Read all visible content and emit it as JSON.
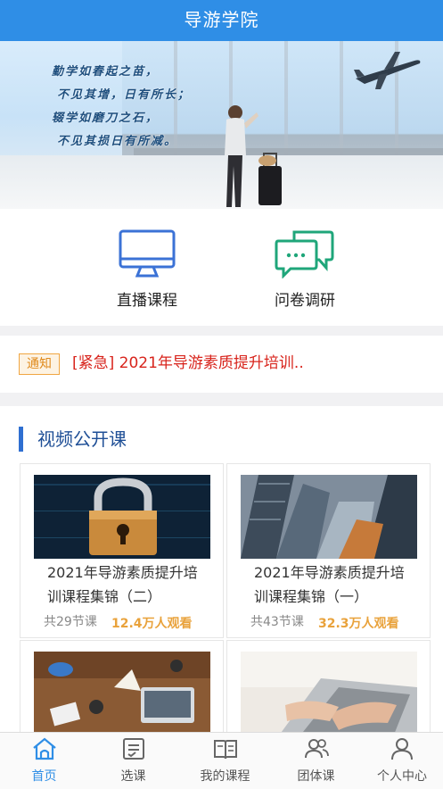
{
  "header": {
    "title": "导游学院"
  },
  "banner": {
    "lines": [
      "勤学如春起之苗，",
      "不见其增，日有所长；",
      "辍学如磨刀之石，",
      "不见其损日有所减。"
    ]
  },
  "quick_links": [
    {
      "label": "直播课程",
      "icon": "monitor-icon"
    },
    {
      "label": "问卷调研",
      "icon": "chat-bubbles-icon"
    }
  ],
  "notice": {
    "tag": "通知",
    "text": "[紧急] 2021年导游素质提升培训.."
  },
  "videos": {
    "title": "视频公开课",
    "cards": [
      {
        "title": "2021年导游素质提升培训课程集锦（二）",
        "lessons": "共29节课",
        "views": "12.4万人观看",
        "thumb": "padlock-image"
      },
      {
        "title": "2021年导游素质提升培训课程集锦（一）",
        "lessons": "共43节课",
        "views": "32.3万人观看",
        "thumb": "skyscrapers-image"
      },
      {
        "title": "",
        "lessons": "",
        "views": "",
        "thumb": "meeting-table-image"
      },
      {
        "title": "",
        "lessons": "",
        "views": "",
        "thumb": "laptop-typing-image"
      }
    ]
  },
  "tabbar": [
    {
      "label": "首页",
      "icon": "home-icon",
      "active": true
    },
    {
      "label": "选课",
      "icon": "course-list-icon",
      "active": false
    },
    {
      "label": "我的课程",
      "icon": "book-icon",
      "active": false
    },
    {
      "label": "团体课",
      "icon": "group-icon",
      "active": false
    },
    {
      "label": "个人中心",
      "icon": "user-icon",
      "active": false
    }
  ],
  "colors": {
    "brand": "#2f8ee6",
    "notice_red": "#d8241c",
    "views_orange": "#e9a23b",
    "section_blue": "#1f4f96"
  }
}
